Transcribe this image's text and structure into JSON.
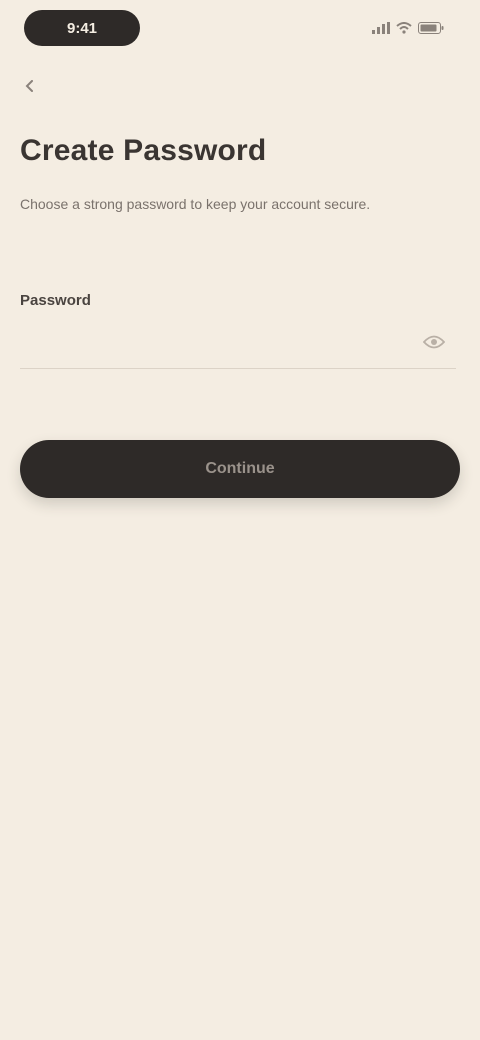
{
  "status_bar": {
    "time": "9:41",
    "signal_icon": "signal-icon",
    "wifi_icon": "wifi-icon",
    "battery_icon": "battery-icon"
  },
  "header": {
    "back_icon": "back-arrow-icon"
  },
  "main": {
    "title": "Create Password",
    "subtitle": "Choose a strong password to keep your account secure.",
    "password_label": "Password",
    "password_placeholder": "",
    "password_value": "",
    "eye_icon": "eye-icon",
    "submit_label": "Continue"
  },
  "colors": {
    "background": "#f4ede2",
    "primary": "#2e2a28",
    "text": "#3a3532",
    "muted": "#7a726c"
  }
}
